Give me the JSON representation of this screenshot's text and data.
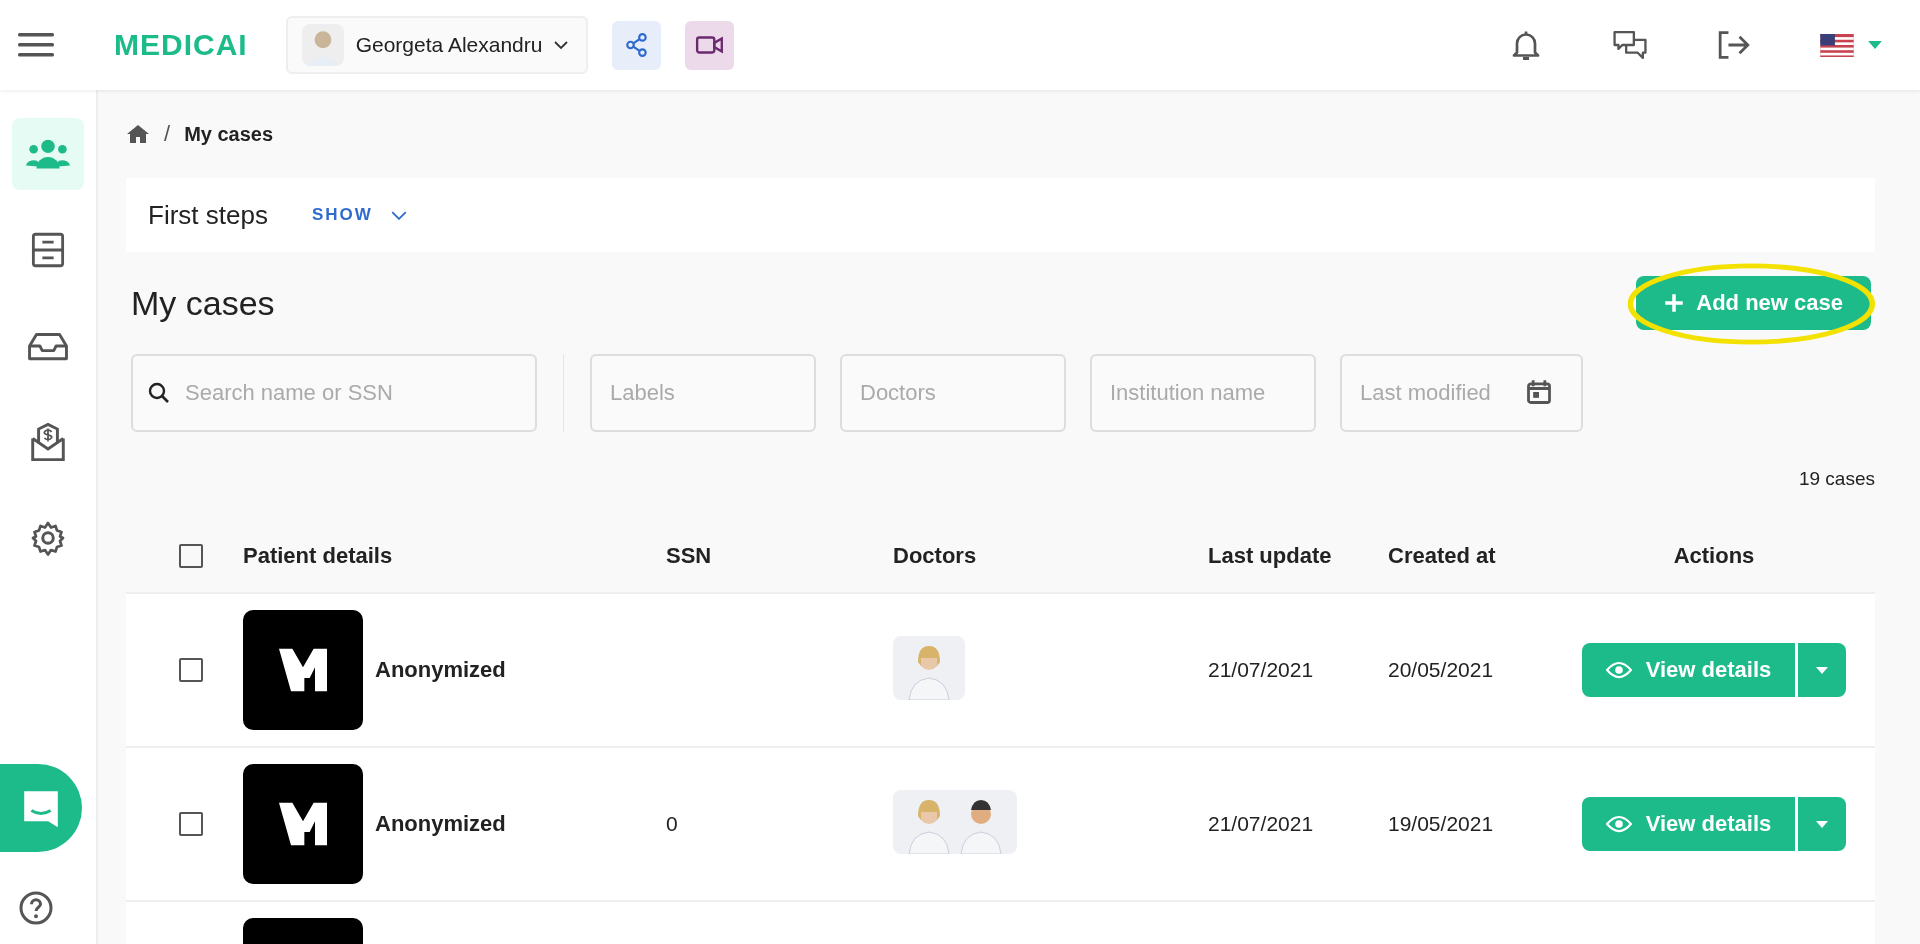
{
  "topbar": {
    "logo": "MEDICAI",
    "account": {
      "name": "Georgeta Alexandru"
    }
  },
  "sidebar": {
    "items": [
      {
        "selected": true
      },
      {
        "selected": false
      },
      {
        "selected": false
      },
      {
        "selected": false
      },
      {
        "selected": false
      }
    ]
  },
  "breadcrumb": {
    "separator": "/",
    "current": "My cases"
  },
  "first_steps": {
    "title": "First steps",
    "toggle": "SHOW",
    "expanded": false
  },
  "page_title": "My cases",
  "add_button": {
    "label": "Add new case",
    "highlighted": true
  },
  "filters": [
    {
      "kind": "search",
      "placeholder": "Search name or SSN"
    },
    {
      "kind": "select",
      "placeholder": "Labels"
    },
    {
      "kind": "select",
      "placeholder": "Doctors"
    },
    {
      "kind": "select",
      "placeholder": "Institution name"
    },
    {
      "kind": "date",
      "placeholder": "Last modified"
    }
  ],
  "case_count": "19 cases",
  "table": {
    "select_all_checked": false,
    "columns": [
      "Patient details",
      "SSN",
      "Doctors",
      "Last update",
      "Created at",
      "Actions"
    ],
    "rows": [
      {
        "kind": "case",
        "checked": false,
        "patient": "Anonymized",
        "doctors": [
          {
            "kind": "female"
          }
        ],
        "last_update": "21/07/2021",
        "created_at": "20/05/2021",
        "action": "View details"
      },
      {
        "kind": "case",
        "checked": false,
        "patient": "Anonymized",
        "ssn": "0",
        "doctors": [
          {
            "kind": "female"
          },
          {
            "kind": "male"
          }
        ],
        "last_update": "21/07/2021",
        "created_at": "19/05/2021",
        "action": "View details"
      },
      {
        "kind": "partial"
      }
    ]
  }
}
